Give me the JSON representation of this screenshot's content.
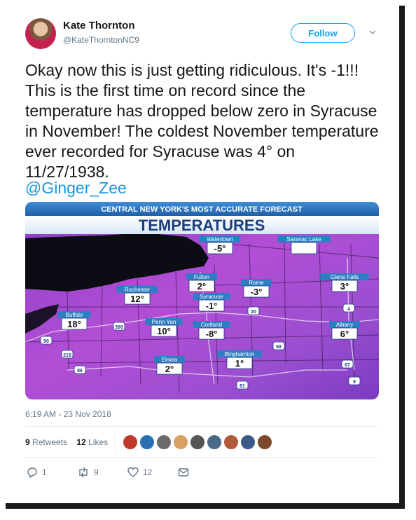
{
  "author": {
    "name": "Kate Thornton",
    "handle": "@KateThorntonNC9"
  },
  "follow_label": "Follow",
  "tweet_text": "Okay now this is just getting ridiculous. It's -1!!! This is the first time on record since the temperature has dropped below zero in Syracuse in November! The coldest November temperature ever recorded for Syracuse was 4° on 11/27/1938.",
  "mention": "@Ginger_Zee",
  "map": {
    "banner": "CENTRAL NEW YORK'S MOST ACCURATE FORECAST",
    "title": "TEMPERATURES",
    "cities": [
      {
        "name": "Watertown",
        "temp": "-5°"
      },
      {
        "name": "Saranac Lake",
        "temp": ""
      },
      {
        "name": "Fulton",
        "temp": "2°"
      },
      {
        "name": "Rome",
        "temp": "-3°"
      },
      {
        "name": "Glens Falls",
        "temp": "3°"
      },
      {
        "name": "Syracuse",
        "temp": "-1°"
      },
      {
        "name": "Rochester",
        "temp": "12°"
      },
      {
        "name": "Buffalo",
        "temp": "18°"
      },
      {
        "name": "Penn Yan",
        "temp": "10°"
      },
      {
        "name": "Cortland",
        "temp": "-8°"
      },
      {
        "name": "Albany",
        "temp": "6°"
      },
      {
        "name": "Binghamton",
        "temp": "1°"
      },
      {
        "name": "Elmira",
        "temp": "2°"
      }
    ],
    "shields": [
      "90",
      "390",
      "219",
      "86",
      "20",
      "88",
      "87",
      "81",
      "4",
      "9"
    ]
  },
  "timestamp": "6:19 AM - 23 Nov 2018",
  "stats": {
    "retweets_count": "9",
    "retweets_label": "Retweets",
    "likes_count": "12",
    "likes_label": "Likes"
  },
  "liker_colors": [
    "#c0392b",
    "#2a6fb0",
    "#6b6b6b",
    "#d9a066",
    "#555555",
    "#4a6a8a",
    "#b05a3a",
    "#3a5a8a",
    "#7a4a2a"
  ],
  "actions": {
    "replies": "1",
    "retweets": "9",
    "likes": "12"
  },
  "colors": {
    "accent": "#1da1f2",
    "mention": "#1b95e0",
    "map_purple": "#9b4fd0",
    "banner_blue": "#2f7ec4"
  }
}
